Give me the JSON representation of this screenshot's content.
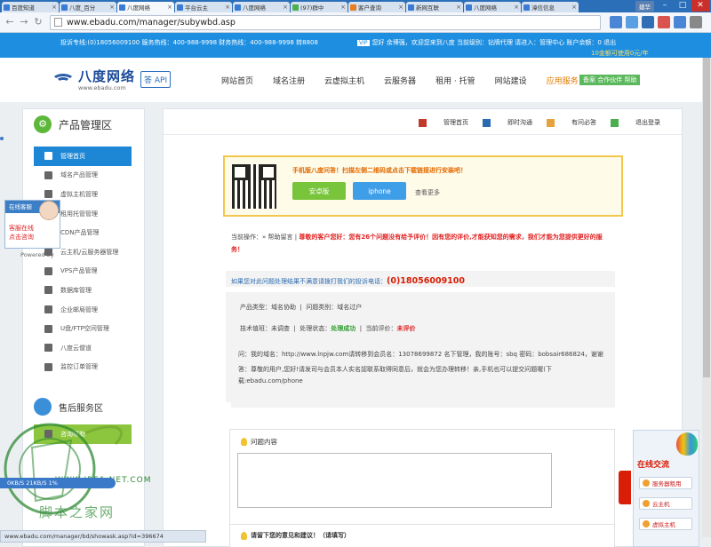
{
  "browser": {
    "tabs": [
      {
        "label": "百度知道",
        "active": false
      },
      {
        "label": "八度_百分",
        "active": false
      },
      {
        "label": "八度网络",
        "active": true
      },
      {
        "label": "平台云主",
        "active": false
      },
      {
        "label": "八度网络",
        "active": false
      },
      {
        "label": "(97)群中",
        "active": false
      },
      {
        "label": "客户查询",
        "active": false
      },
      {
        "label": "新网互联",
        "active": false
      },
      {
        "label": "八度网络",
        "active": false
      },
      {
        "label": "漳信信息",
        "active": false
      }
    ],
    "user_label": "建华",
    "url": "www.ebadu.com/manager/subywbd.asp",
    "status_url": "www.ebadu.com/manager/bd/showask.asp?id=396674"
  },
  "infobar": {
    "hotline": "投诉专线:(0)18056009100  服务热线：400-988-9998  财务热线：400-988-9998 转8808",
    "badge": "VIP",
    "welcome": "您好 余博强，欢迎您来到八度 当前级别：钻牌代理 请进入：管理中心   账户余额：0    退出",
    "coupon": "10金额可使用0元/年"
  },
  "header": {
    "logo_cn": "八度网络",
    "logo_en": "www.ebadu.com",
    "answer_label": "答 API",
    "nav": [
      "网站首页",
      "域名注册",
      "云虚拟主机",
      "云服务器",
      "租用 · 托管",
      "网站建设",
      "应用服务"
    ],
    "partner": "备案   合作伙伴   帮助"
  },
  "sidebar": {
    "title": "产品管理区",
    "items": [
      {
        "label": "管理首页",
        "active": true
      },
      {
        "label": "域名产品管理"
      },
      {
        "label": "虚拟主机管理"
      },
      {
        "label": "租用托管管理"
      },
      {
        "label": "CDN产品管理"
      },
      {
        "label": "云主机/云服务器管理"
      },
      {
        "label": "VPS产品管理"
      },
      {
        "label": "数据库管理"
      },
      {
        "label": "企业邮局管理"
      },
      {
        "label": "U盘/FTP空间管理"
      },
      {
        "label": "八度云僧道"
      },
      {
        "label": "监控订单管理"
      }
    ],
    "service_title": "售后服务区",
    "service_item": "咨询帮助"
  },
  "main": {
    "toplinks": [
      "管理首页",
      "即时沟通",
      "有问必答",
      "退出登录"
    ],
    "app": {
      "message": "手机版八度问答！扫描左侧二维码或点击下载链接进行安装吧！",
      "android": "安卓版",
      "iphone": "iphone",
      "more": "查看更多"
    },
    "oppath_prefix": "当前操作：» 帮助留言 |",
    "oppath_notice": "尊敬的客户您好：您有26个问题没有给予评价！因有您的评价,才能获知您的需求，我们才能为您提供更好的服务！",
    "complaint_text": "如果您对此问题处理结果不满意请拨打我们的投诉电话：",
    "complaint_phone": "(0)18056009100",
    "product_type_label": "产品类型：域名协助",
    "problem_type_label": "问题类别：域名过户",
    "tech_label": "技术值班：",
    "tech_value": "未调查",
    "status_label": "处理状态：",
    "status_value": "处理成功",
    "rating_label": "当前评价：",
    "rating_value": "未评价",
    "question": "问：我的域名：http://www.lnpjw.com请转移到会员名：13078699872 名下管理，我的账号：sbq 密码：bobsair686824，谢谢",
    "answer": "答：尊敬的用户,您好!请发司与会员本人实名認联系取得同意后，就会为您办理转移！亲,手机也可以提交问题喔(下载:ebadu.com/phone",
    "content_label": "问题内容",
    "feedback_label": "请留下您的意见和建议！（请填写）"
  },
  "widgets": {
    "kefu_header": "在线客服",
    "kefu_row1": "客服在线",
    "kefu_row2": "点击咨询",
    "powered": "Powered by",
    "online_title": "在线交流",
    "online_items": [
      "服务器租用",
      "云主机",
      "虚拟主机"
    ],
    "netmon": "0KB/S     21KB/S    1%"
  },
  "watermark": {
    "line1": "WWW.JB51.NET.COM",
    "line2": "脚本之家网"
  }
}
